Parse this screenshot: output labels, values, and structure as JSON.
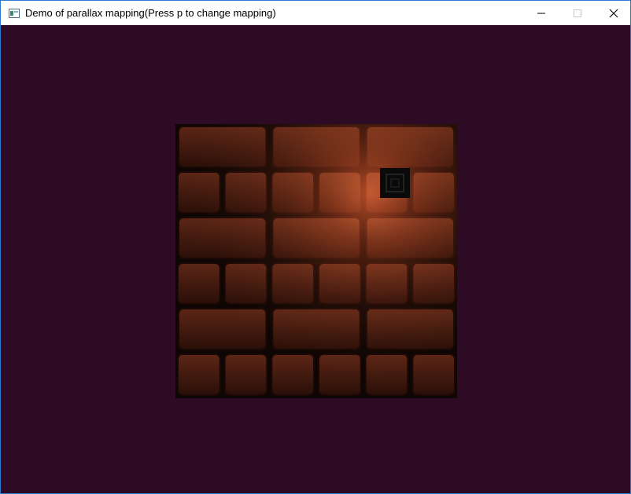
{
  "window": {
    "title": "Demo of parallax mapping(Press p to change mapping)",
    "icon": "app-window-icon",
    "controls": {
      "minimize_icon": "minimize-icon",
      "maximize_icon": "maximize-icon",
      "close_icon": "close-icon"
    }
  },
  "scene": {
    "background_color": "#2e0b24",
    "quad_texture": "brick-wall-parallax-mapped",
    "light_color": "#e06a3c",
    "brick_color": "#5a2414"
  }
}
